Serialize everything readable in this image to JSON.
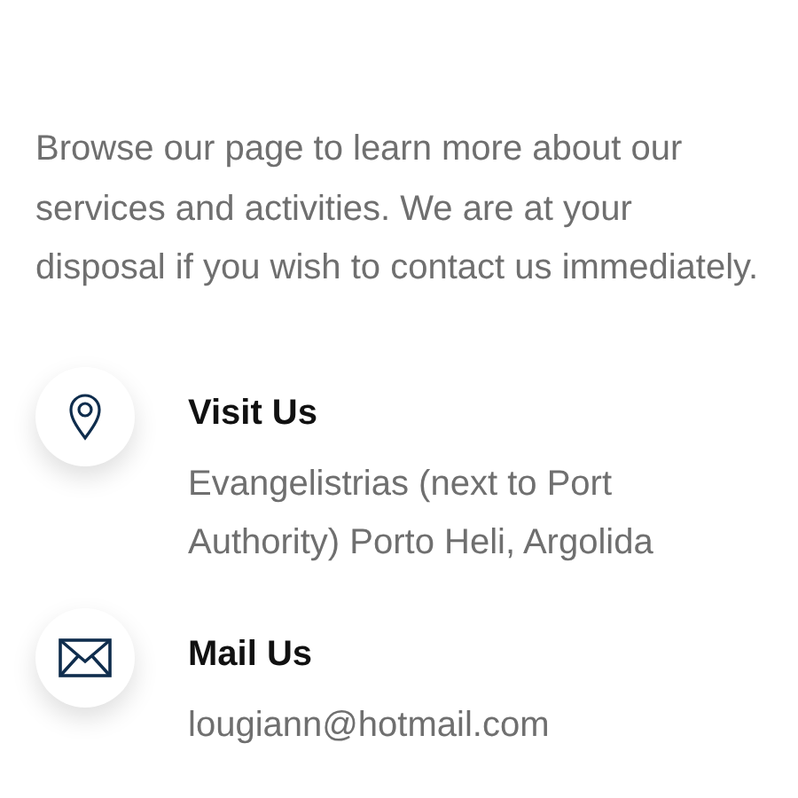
{
  "intro": "Browse our page to learn more about our services and activities. We are at your disposal if you wish to contact us immediately.",
  "contacts": [
    {
      "kind": "location",
      "title": "Visit Us",
      "text": "Evangelistrias (next to Port Authority) Porto Heli, Argolida"
    },
    {
      "kind": "mail",
      "title": "Mail Us",
      "text": "lougiann@hotmail.com"
    }
  ]
}
